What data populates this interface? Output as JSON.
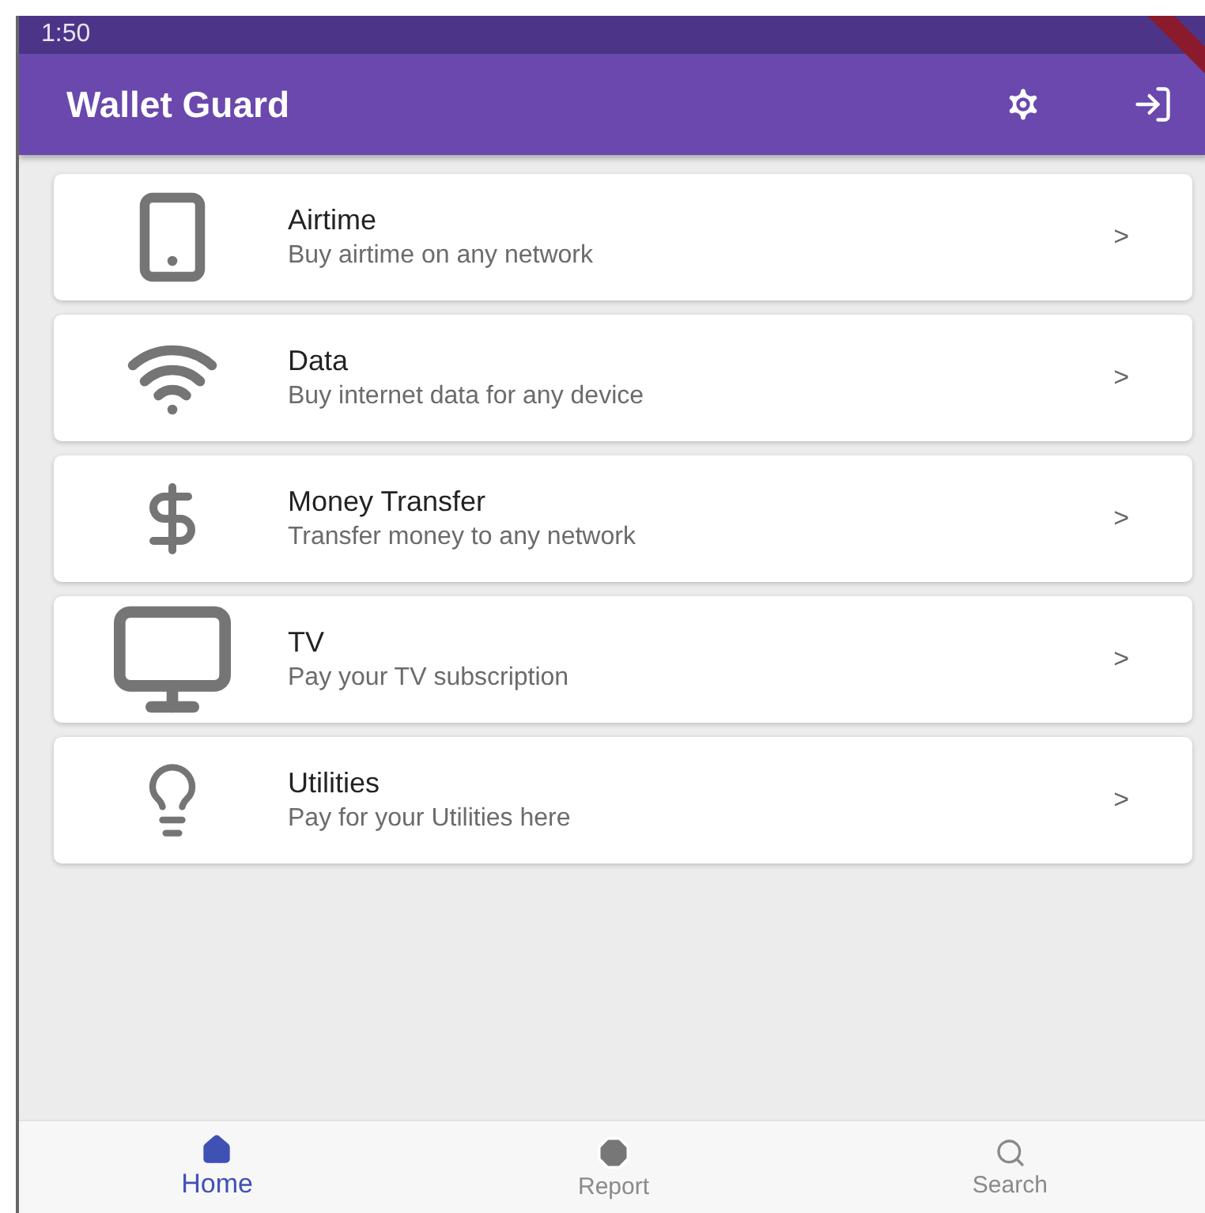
{
  "status_bar": {
    "time": "1:50"
  },
  "app_bar": {
    "title": "Wallet Guard"
  },
  "services": [
    {
      "kind": "phone",
      "title": "Airtime",
      "subtitle": "Buy airtime on any network",
      "chevron": ">"
    },
    {
      "kind": "wifi",
      "title": "Data",
      "subtitle": "Buy internet data for any device",
      "chevron": ">"
    },
    {
      "kind": "dollar",
      "title": "Money Transfer",
      "subtitle": "Transfer money to any network",
      "chevron": ">"
    },
    {
      "kind": "tv",
      "title": "TV",
      "subtitle": "Pay your TV subscription",
      "chevron": ">"
    },
    {
      "kind": "bulb",
      "title": "Utilities",
      "subtitle": "Pay for your Utilities here",
      "chevron": ">"
    }
  ],
  "bottom_nav": [
    {
      "kind": "home",
      "label": "Home",
      "selected": true
    },
    {
      "kind": "report",
      "label": "Report",
      "selected": false
    },
    {
      "kind": "search",
      "label": "Search",
      "selected": false
    }
  ]
}
